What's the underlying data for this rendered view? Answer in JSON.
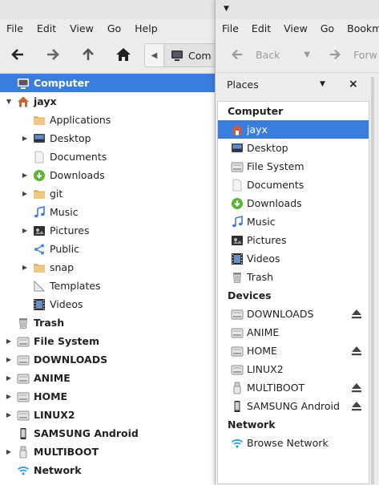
{
  "left_window": {
    "menu": [
      "File",
      "Edit",
      "View",
      "Go",
      "Help"
    ],
    "toolbar": {
      "back": "arrow-left-icon",
      "forward": "arrow-right-icon",
      "up": "arrow-up-icon",
      "home": "home-icon"
    },
    "location": {
      "crumb_label": "Com"
    },
    "tree": [
      {
        "label": "Computer",
        "icon": "monitor-icon",
        "expander": "",
        "indent": 0,
        "bold": true,
        "selected": true
      },
      {
        "label": "jayx",
        "icon": "home-folder-icon",
        "expander": "down",
        "indent": 0,
        "bold": true
      },
      {
        "label": "Applications",
        "icon": "folder-icon",
        "expander": "",
        "indent": 1
      },
      {
        "label": "Desktop",
        "icon": "desktop-icon",
        "expander": "right",
        "indent": 1
      },
      {
        "label": "Documents",
        "icon": "document-icon",
        "expander": "",
        "indent": 1
      },
      {
        "label": "Downloads",
        "icon": "download-icon",
        "expander": "right",
        "indent": 1
      },
      {
        "label": "git",
        "icon": "folder-icon",
        "expander": "right",
        "indent": 1
      },
      {
        "label": "Music",
        "icon": "music-icon",
        "expander": "",
        "indent": 1
      },
      {
        "label": "Pictures",
        "icon": "pictures-icon",
        "expander": "right",
        "indent": 1
      },
      {
        "label": "Public",
        "icon": "share-icon",
        "expander": "",
        "indent": 1
      },
      {
        "label": "snap",
        "icon": "folder-icon",
        "expander": "right",
        "indent": 1
      },
      {
        "label": "Templates",
        "icon": "templates-icon",
        "expander": "",
        "indent": 1
      },
      {
        "label": "Videos",
        "icon": "video-icon",
        "expander": "",
        "indent": 1
      },
      {
        "label": "Trash",
        "icon": "trash-icon",
        "expander": "",
        "indent": 0,
        "bold": true
      },
      {
        "label": "File System",
        "icon": "drive-icon",
        "expander": "right",
        "indent": 0,
        "bold": true
      },
      {
        "label": "DOWNLOADS",
        "icon": "drive-icon",
        "expander": "right",
        "indent": 0,
        "bold": true
      },
      {
        "label": "ANIME",
        "icon": "drive-icon",
        "expander": "right",
        "indent": 0,
        "bold": true
      },
      {
        "label": "HOME",
        "icon": "drive-icon",
        "expander": "right",
        "indent": 0,
        "bold": true
      },
      {
        "label": "LINUX2",
        "icon": "drive-icon",
        "expander": "right",
        "indent": 0,
        "bold": true
      },
      {
        "label": "SAMSUNG Android",
        "icon": "phone-icon",
        "expander": "",
        "indent": 0,
        "bold": true
      },
      {
        "label": "MULTIBOOT",
        "icon": "usb-icon",
        "expander": "right",
        "indent": 0,
        "bold": true
      },
      {
        "label": "Network",
        "icon": "wifi-icon",
        "expander": "",
        "indent": 0,
        "bold": true
      }
    ]
  },
  "right_window": {
    "menu": [
      "File",
      "Edit",
      "View",
      "Go",
      "Bookmar"
    ],
    "toolbar": {
      "back_label": "Back",
      "forward_label": "Forw"
    },
    "places_title": "Places",
    "sections": [
      {
        "heading": "Computer",
        "items": [
          {
            "label": "jayx",
            "icon": "home-folder-icon",
            "selected": true
          },
          {
            "label": "Desktop",
            "icon": "desktop-icon"
          },
          {
            "label": "File System",
            "icon": "drive-icon"
          },
          {
            "label": "Documents",
            "icon": "document-icon"
          },
          {
            "label": "Downloads",
            "icon": "download-icon"
          },
          {
            "label": "Music",
            "icon": "music-icon"
          },
          {
            "label": "Pictures",
            "icon": "pictures-icon"
          },
          {
            "label": "Videos",
            "icon": "video-icon"
          },
          {
            "label": "Trash",
            "icon": "trash-icon"
          }
        ]
      },
      {
        "heading": "Devices",
        "items": [
          {
            "label": "DOWNLOADS",
            "icon": "drive-icon",
            "eject": true
          },
          {
            "label": "ANIME",
            "icon": "drive-icon"
          },
          {
            "label": "HOME",
            "icon": "drive-icon",
            "eject": true
          },
          {
            "label": "LINUX2",
            "icon": "drive-icon"
          },
          {
            "label": "MULTIBOOT",
            "icon": "usb-icon",
            "eject": true
          },
          {
            "label": "SAMSUNG Android",
            "icon": "phone-icon",
            "eject": true
          }
        ]
      },
      {
        "heading": "Network",
        "items": [
          {
            "label": "Browse Network",
            "icon": "wifi-icon"
          }
        ]
      }
    ]
  },
  "colors": {
    "selection": "#3b7ddd",
    "folder": "#e2b66b",
    "download_green": "#5cb531",
    "music_blue": "#3a7bd5",
    "wifi_blue": "#2d9fe0"
  }
}
